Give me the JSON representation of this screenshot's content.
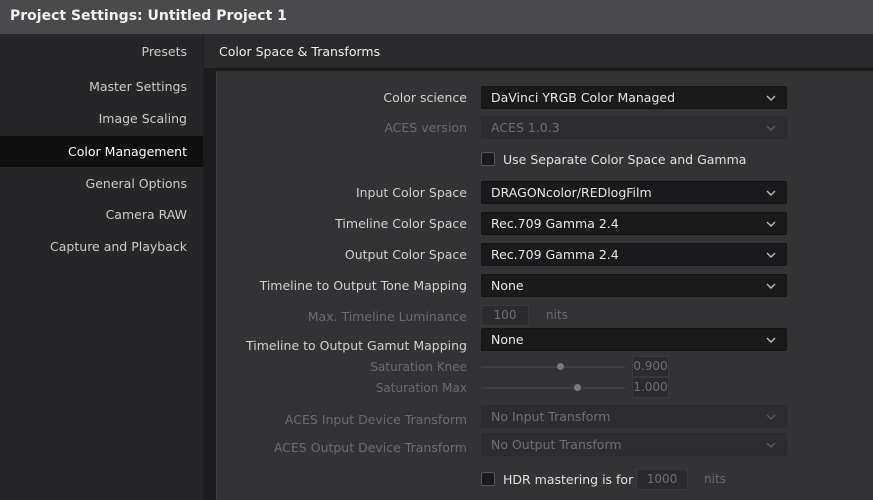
{
  "window": {
    "title": "Project Settings:  Untitled Project 1"
  },
  "sidebar": {
    "items": [
      {
        "label": "Presets"
      },
      {
        "label": "Master Settings"
      },
      {
        "label": "Image Scaling"
      },
      {
        "label": "Color Management"
      },
      {
        "label": "General Options"
      },
      {
        "label": "Camera RAW"
      },
      {
        "label": "Capture and Playback"
      }
    ],
    "active": "Color Management"
  },
  "section": {
    "title": "Color Space & Transforms"
  },
  "fields": {
    "color_science": {
      "label": "Color science",
      "value": "DaVinci YRGB Color Managed"
    },
    "aces_version": {
      "label": "ACES version",
      "value": "ACES 1.0.3"
    },
    "separate_cs": {
      "label": "Use Separate Color Space and Gamma",
      "checked": false
    },
    "input_cs": {
      "label": "Input Color Space",
      "value": "DRAGONcolor/REDlogFilm"
    },
    "timeline_cs": {
      "label": "Timeline Color Space",
      "value": "Rec.709 Gamma 2.4"
    },
    "output_cs": {
      "label": "Output Color Space",
      "value": "Rec.709 Gamma 2.4"
    },
    "tone_mapping": {
      "label": "Timeline to Output Tone Mapping",
      "value": "None"
    },
    "max_luminance": {
      "label": "Max. Timeline Luminance",
      "value": "100",
      "unit": "nits"
    },
    "gamut_mapping": {
      "label": "Timeline to Output Gamut Mapping",
      "value": "None"
    },
    "saturation_knee": {
      "label": "Saturation Knee",
      "value": "0.900",
      "level": 0.55
    },
    "saturation_max": {
      "label": "Saturation Max",
      "value": "1.000",
      "level": 0.67
    },
    "aces_idt": {
      "label": "ACES Input Device Transform",
      "value": "No Input Transform"
    },
    "aces_odt": {
      "label": "ACES Output Device Transform",
      "value": "No Output Transform"
    },
    "hdr_mastering": {
      "label": "HDR mastering is for",
      "value": "1000",
      "unit": "nits",
      "checked": false
    }
  }
}
